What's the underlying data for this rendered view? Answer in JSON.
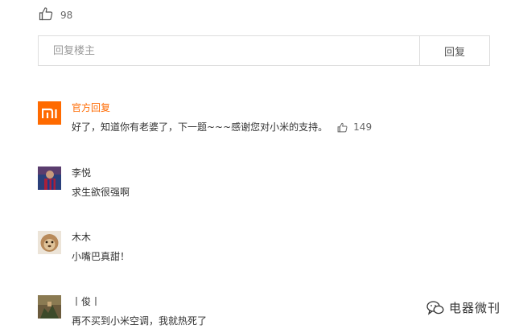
{
  "top_like": {
    "icon": "thumbs-up-icon",
    "count": "98"
  },
  "reply": {
    "placeholder": "回复楼主",
    "button_label": "回复"
  },
  "comments": [
    {
      "name": "官方回复",
      "text": "好了，知道你有老婆了，下一题~~~感谢您对小米的支持。",
      "likes": "149",
      "avatar_text": "mi",
      "official": true
    },
    {
      "name": "李悦",
      "text": "求生欲很强啊"
    },
    {
      "name": "木木",
      "text": "小嘴巴真甜！"
    },
    {
      "name": "丨俊丨",
      "text": "再不买到小米空调，我就热死了"
    }
  ],
  "watermark": {
    "icon": "wechat-icon",
    "text": "电器微刊"
  },
  "colors": {
    "official": "#ff6a00",
    "border": "#dddddd",
    "placeholder": "#999999"
  }
}
